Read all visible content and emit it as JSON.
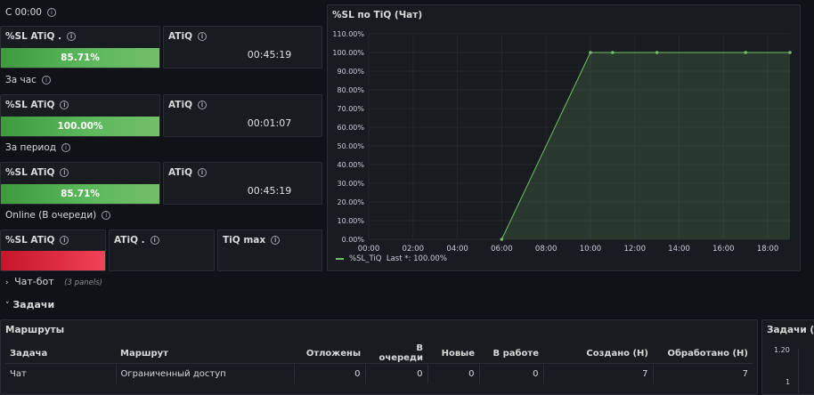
{
  "rows": {
    "since_midnight": "С 00:00",
    "per_hour": "За час",
    "per_period": "За период",
    "online": "Online (В очереди)"
  },
  "stats": {
    "since_midnight": {
      "sl_title": "%SL ATiQ .",
      "sl_value": "85.71%",
      "sl_fraction": 0.8571,
      "atiq_title": "ATiQ",
      "atiq_value": "00:45:19"
    },
    "per_hour": {
      "sl_title": "%SL ATiQ",
      "sl_value": "100.00%",
      "sl_fraction": 1.0,
      "atiq_title": "ATiQ",
      "atiq_value": "00:01:07"
    },
    "per_period": {
      "sl_title": "%SL ATiQ",
      "sl_value": "85.71%",
      "sl_fraction": 0.8571,
      "atiq_title": "ATiQ",
      "atiq_value": "00:45:19"
    },
    "online": {
      "sl_title": "%SL ATiQ",
      "atiq_title": "ATiQ .",
      "tiq_title": "TiQ max"
    }
  },
  "chart_panel": {
    "title": "%SL по TiQ (Чат)",
    "legend_series": "%SL_TiQ",
    "legend_last": "Last *: 100.00%",
    "series_color": "#73bf69"
  },
  "chart_data": {
    "type": "area",
    "title": "%SL по TiQ (Чат)",
    "x_ticks": [
      "00:00",
      "02:00",
      "04:00",
      "06:00",
      "08:00",
      "10:00",
      "12:00",
      "14:00",
      "16:00",
      "18:00"
    ],
    "y_ticks": [
      "0.00%",
      "10.00%",
      "20.00%",
      "30.00%",
      "40.00%",
      "50.00%",
      "60.00%",
      "70.00%",
      "80.00%",
      "90.00%",
      "100.00%",
      "110.00%"
    ],
    "ylim": [
      0,
      110
    ],
    "xlim_hours": [
      0,
      19
    ],
    "series": [
      {
        "name": "%SL_TiQ",
        "x_hours": [
          6,
          10,
          11,
          13,
          17,
          19
        ],
        "values": [
          0,
          100,
          100,
          100,
          100,
          100
        ]
      }
    ]
  },
  "collapsed_row": {
    "title": "Чат-бот",
    "meta": "(3 panels)"
  },
  "tasks_row": {
    "title": "Задачи"
  },
  "routes_panel": {
    "title": "Маршруты",
    "columns": [
      "Задача",
      "Маршрут",
      "Отложены",
      "В очереди",
      "Новые",
      "В работе",
      "Создано (Н)",
      "Обработано (Н)"
    ],
    "rows": [
      [
        "Чат",
        "Ограниченный доступ",
        "0",
        "0",
        "0",
        "0",
        "7",
        "7"
      ]
    ]
  },
  "side_panel": {
    "title": "Задачи (Ча",
    "y_top": "1.20",
    "y_bottom": "1"
  }
}
